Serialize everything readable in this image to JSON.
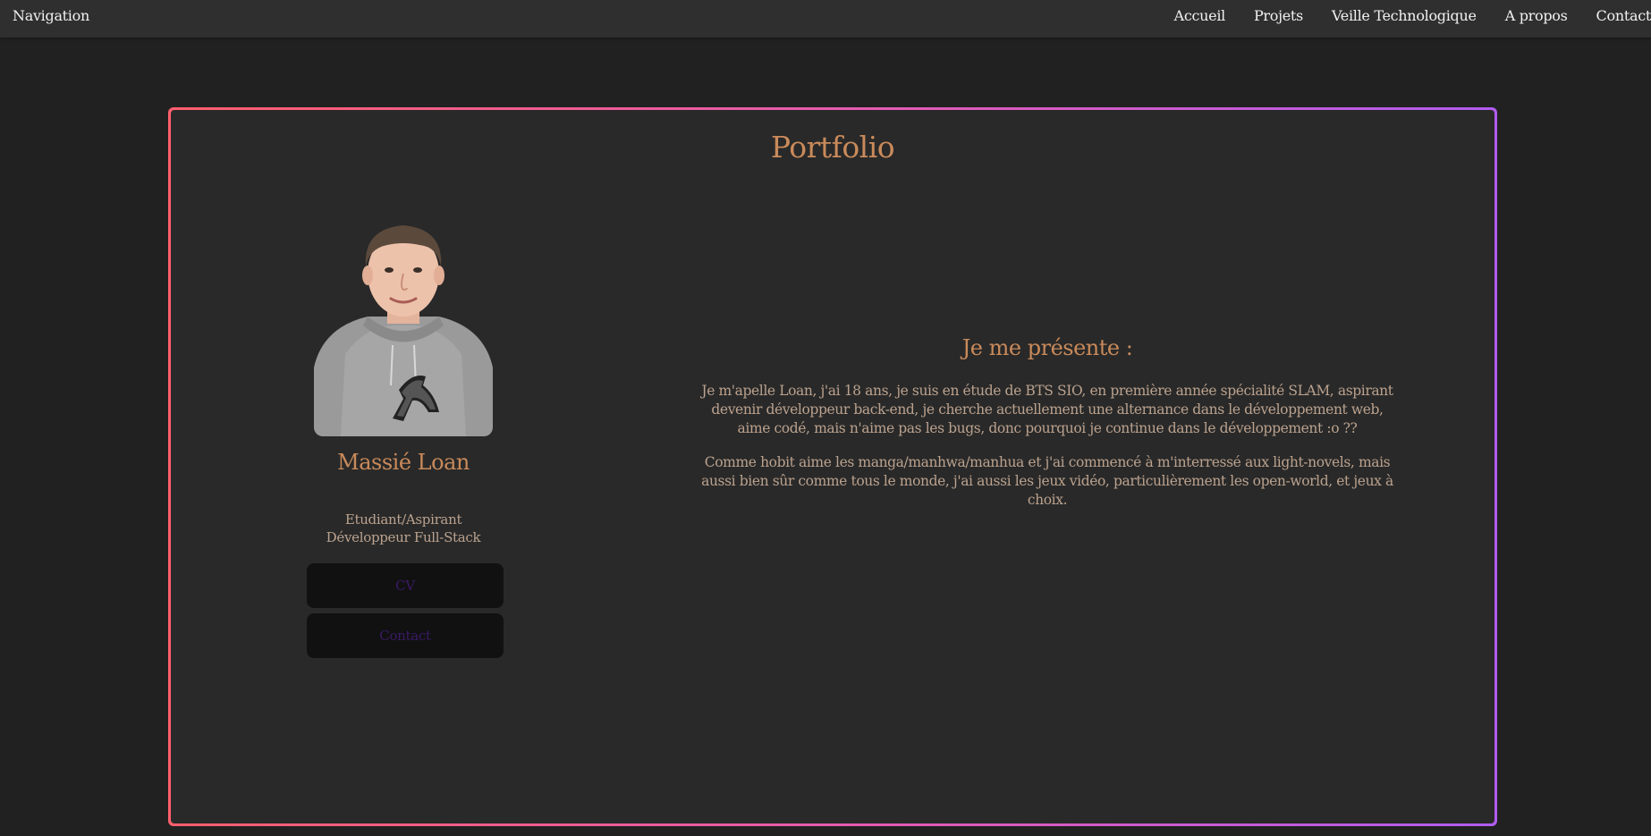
{
  "nav": {
    "brand": "Navigation",
    "links": [
      "Accueil",
      "Projets",
      "Veille Technologique",
      "A propos",
      "Contact"
    ]
  },
  "page": {
    "title": "Portfolio"
  },
  "profile": {
    "name": "Massié Loan",
    "role_line1": "Etudiant/Aspirant",
    "role_line2": "Développeur Full-Stack",
    "cv_button": "CV",
    "contact_button": "Contact"
  },
  "intro": {
    "title": "Je me présente :",
    "paragraph1": "Je m'apelle Loan, j'ai 18 ans, je suis en étude de BTS SIO, en première année spécialité SLAM, aspirant devenir développeur back-end, je cherche actuellement une alternance dans le développement web, aime codé, mais n'aime pas les bugs, donc pourquoi je continue dans le développement :o ??",
    "paragraph2": "Comme hobit aime les manga/manhwa/manhua et j'ai commencé à m'interressé aux light-novels, mais aussi bien sûr comme tous le monde, j'ai aussi les jeux vidéo, particulièrement les open-world, et jeux à choix."
  },
  "colors": {
    "background": "#212121",
    "navbar": "#2f2f2f",
    "panel": "#292929",
    "accent": "#c98a5a",
    "text": "#bba28e",
    "border_gradient_start": "#ff5f6d",
    "border_gradient_end": "#b05cf0",
    "button_bg": "#111111",
    "button_text": "#3a1a66"
  }
}
